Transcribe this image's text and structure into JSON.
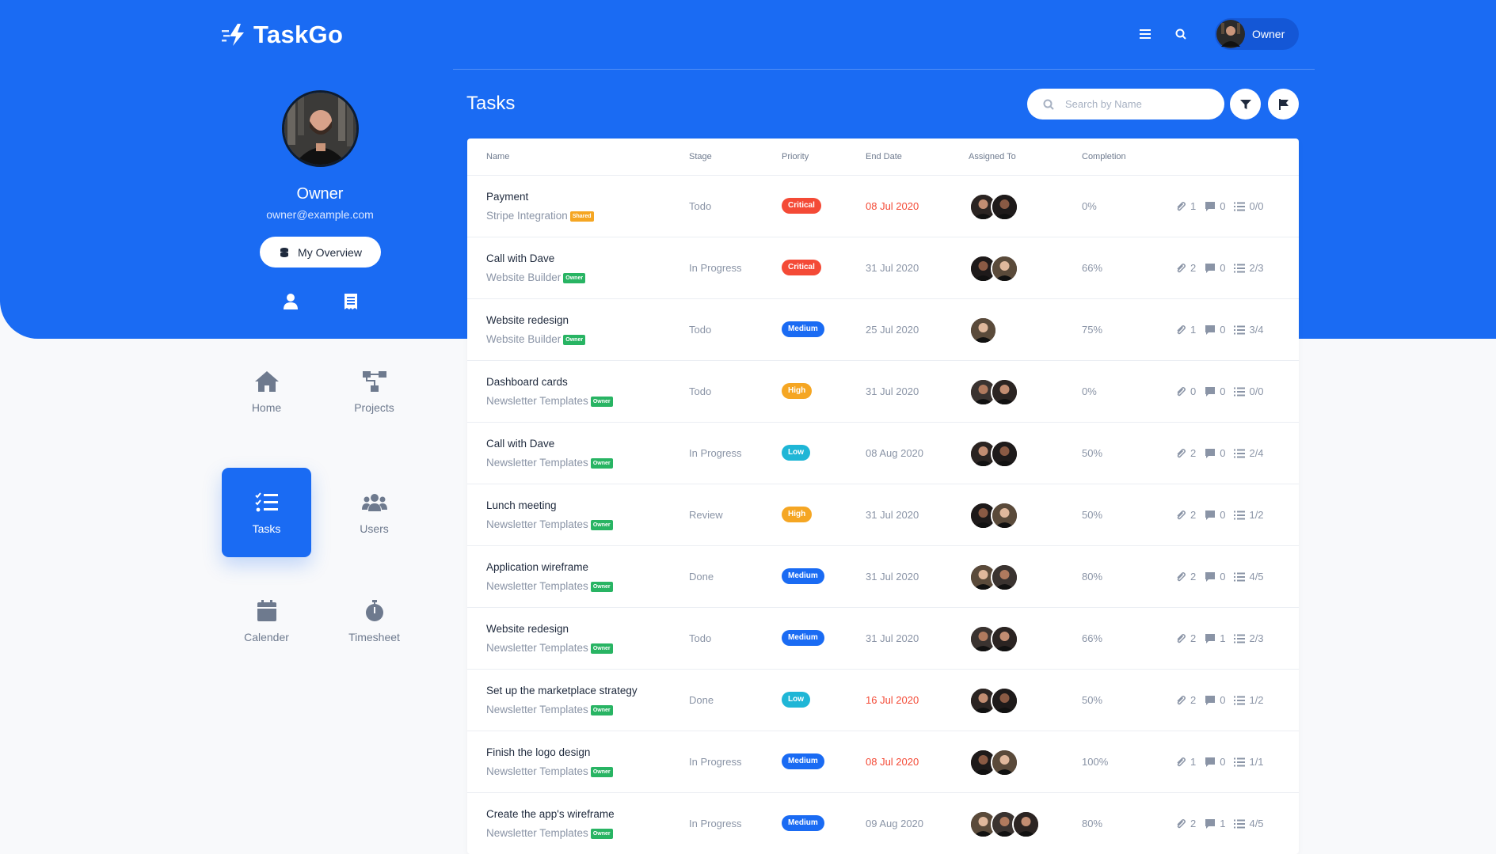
{
  "app": {
    "name": "TaskGo"
  },
  "header": {
    "menu_icon": "hamburger-icon",
    "search_icon": "search-icon",
    "user_label": "Owner"
  },
  "profile": {
    "name": "Owner",
    "email": "owner@example.com",
    "overview_label": "My Overview"
  },
  "nav": {
    "items": [
      {
        "label": "Home",
        "icon": "home-icon",
        "active": false
      },
      {
        "label": "Projects",
        "icon": "projects-icon",
        "active": false
      },
      {
        "label": "Tasks",
        "icon": "tasks-icon",
        "active": true
      },
      {
        "label": "Users",
        "icon": "users-icon",
        "active": false
      },
      {
        "label": "Calender",
        "icon": "calendar-icon",
        "active": false
      },
      {
        "label": "Timesheet",
        "icon": "stopwatch-icon",
        "active": false
      }
    ]
  },
  "tasks": {
    "title": "Tasks",
    "search_placeholder": "Search by Name",
    "columns": [
      "Name",
      "Stage",
      "Priority",
      "End Date",
      "Assigned To",
      "Completion"
    ],
    "colors": {
      "primary": "#1a6bf3",
      "critical": "#f44a36",
      "medium": "#1a6bf3",
      "high": "#f5a623",
      "low": "#1fb6d6",
      "owner_tag": "#28b463",
      "shared_tag": "#f5a623"
    },
    "rows": [
      {
        "name": "Payment",
        "project": "Stripe Integration",
        "tag": "Shared",
        "stage": "Todo",
        "priority": "Critical",
        "end_date": "08 Jul 2020",
        "overdue": true,
        "assignees": 2,
        "completion": "0%",
        "attachments": "1",
        "comments": "0",
        "checklist": "0/0"
      },
      {
        "name": "Call with Dave",
        "project": "Website Builder",
        "tag": "Owner",
        "stage": "In Progress",
        "priority": "Critical",
        "end_date": "31 Jul 2020",
        "overdue": false,
        "assignees": 2,
        "completion": "66%",
        "attachments": "2",
        "comments": "0",
        "checklist": "2/3"
      },
      {
        "name": "Website redesign",
        "project": "Website Builder",
        "tag": "Owner",
        "stage": "Todo",
        "priority": "Medium",
        "end_date": "25 Jul 2020",
        "overdue": false,
        "assignees": 1,
        "completion": "75%",
        "attachments": "1",
        "comments": "0",
        "checklist": "3/4"
      },
      {
        "name": "Dashboard cards",
        "project": "Newsletter Templates",
        "tag": "Owner",
        "stage": "Todo",
        "priority": "High",
        "end_date": "31 Jul 2020",
        "overdue": false,
        "assignees": 2,
        "completion": "0%",
        "attachments": "0",
        "comments": "0",
        "checklist": "0/0"
      },
      {
        "name": "Call with Dave",
        "project": "Newsletter Templates",
        "tag": "Owner",
        "stage": "In Progress",
        "priority": "Low",
        "end_date": "08 Aug 2020",
        "overdue": false,
        "assignees": 2,
        "completion": "50%",
        "attachments": "2",
        "comments": "0",
        "checklist": "2/4"
      },
      {
        "name": "Lunch meeting",
        "project": "Newsletter Templates",
        "tag": "Owner",
        "stage": "Review",
        "priority": "High",
        "end_date": "31 Jul 2020",
        "overdue": false,
        "assignees": 2,
        "completion": "50%",
        "attachments": "2",
        "comments": "0",
        "checklist": "1/2"
      },
      {
        "name": "Application wireframe",
        "project": "Newsletter Templates",
        "tag": "Owner",
        "stage": "Done",
        "priority": "Medium",
        "end_date": "31 Jul 2020",
        "overdue": false,
        "assignees": 2,
        "completion": "80%",
        "attachments": "2",
        "comments": "0",
        "checklist": "4/5"
      },
      {
        "name": "Website redesign",
        "project": "Newsletter Templates",
        "tag": "Owner",
        "stage": "Todo",
        "priority": "Medium",
        "end_date": "31 Jul 2020",
        "overdue": false,
        "assignees": 2,
        "completion": "66%",
        "attachments": "2",
        "comments": "1",
        "checklist": "2/3"
      },
      {
        "name": "Set up the marketplace strategy",
        "project": "Newsletter Templates",
        "tag": "Owner",
        "stage": "Done",
        "priority": "Low",
        "end_date": "16 Jul 2020",
        "overdue": true,
        "assignees": 2,
        "completion": "50%",
        "attachments": "2",
        "comments": "0",
        "checklist": "1/2"
      },
      {
        "name": "Finish the logo design",
        "project": "Newsletter Templates",
        "tag": "Owner",
        "stage": "In Progress",
        "priority": "Medium",
        "end_date": "08 Jul 2020",
        "overdue": true,
        "assignees": 2,
        "completion": "100%",
        "attachments": "1",
        "comments": "0",
        "checklist": "1/1"
      },
      {
        "name": "Create the app's wireframe",
        "project": "Newsletter Templates",
        "tag": "Owner",
        "stage": "In Progress",
        "priority": "Medium",
        "end_date": "09 Aug 2020",
        "overdue": false,
        "assignees": 3,
        "completion": "80%",
        "attachments": "2",
        "comments": "1",
        "checklist": "4/5"
      }
    ]
  }
}
